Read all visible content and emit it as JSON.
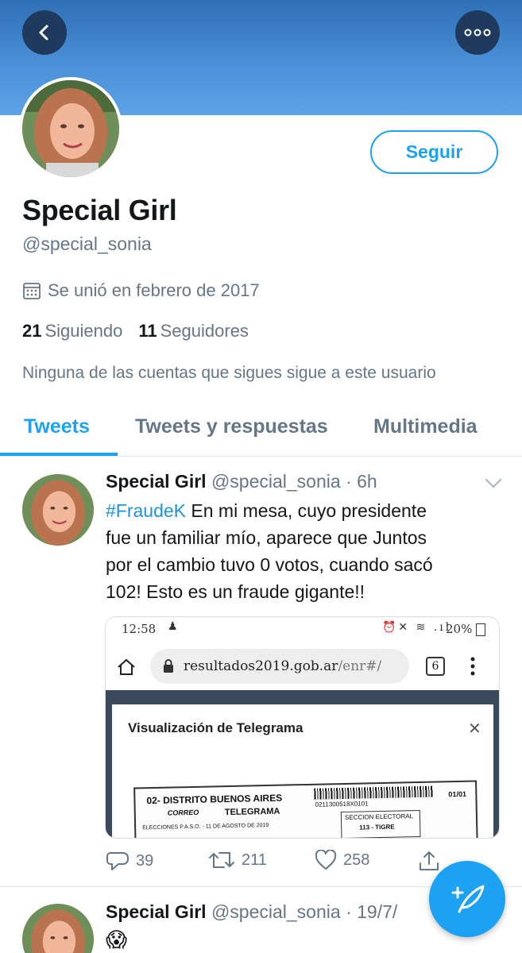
{
  "header": {
    "back_label": "Back",
    "more_label": "More"
  },
  "profile": {
    "follow_label": "Seguir",
    "name": "Special Girl",
    "handle": "@special_sonia",
    "joined": "Se unió en febrero de 2017",
    "following_count": "21",
    "following_label": "Siguiendo",
    "followers_count": "11",
    "followers_label": "Seguidores",
    "mutual_note": "Ninguna de las cuentas que sigues sigue a este usuario"
  },
  "tabs": [
    {
      "label": "Tweets",
      "active": true
    },
    {
      "label": "Tweets y respuestas",
      "active": false
    },
    {
      "label": "Multimedia",
      "active": false
    }
  ],
  "tweets": [
    {
      "name": "Special Girl",
      "handle": "@special_sonia",
      "time": "· 6h",
      "hashtag": "#FraudeK",
      "text_line1": " En mi mesa, cuyo presidente",
      "text_line2": "fue un familiar mío, aparece que Juntos",
      "text_line3": "por el cambio tuvo 0 votos, cuando sacó",
      "text_line4": "102! Esto es un fraude gigante!!",
      "media": {
        "status_time": "12:58",
        "status_battery": "20%",
        "url_domain": "resultados2019.gob.ar",
        "url_path": "/enr#/",
        "tab_count": "6",
        "modal_title": "Visualización de Telegrama",
        "doc_district": "02- DISTRITO BUENOS AIRES",
        "doc_type": "TELEGRAMA",
        "doc_section": "SECCION ELECTORAL",
        "doc_place": "113 - TIGRE",
        "doc_page": "01/01",
        "doc_code": "0211300518X0101",
        "doc_election": "ELECCIONES P.A.S.O. - 11 DE AGOSTO DE 2019",
        "doc_brand": "CORREO"
      },
      "replies": "39",
      "retweets": "211",
      "likes": "258"
    },
    {
      "name": "Special Girl",
      "handle": "@special_sonia",
      "time": "· 19/7/",
      "text": "😱"
    }
  ],
  "colors": {
    "accent": "#1da1f2",
    "muted": "#657786",
    "text": "#14171a",
    "banner": "#4a90d9"
  },
  "icons": [
    "back-icon",
    "more-icon",
    "calendar-icon",
    "chevron-down-icon",
    "reply-icon",
    "retweet-icon",
    "like-icon",
    "share-icon",
    "compose-icon"
  ]
}
